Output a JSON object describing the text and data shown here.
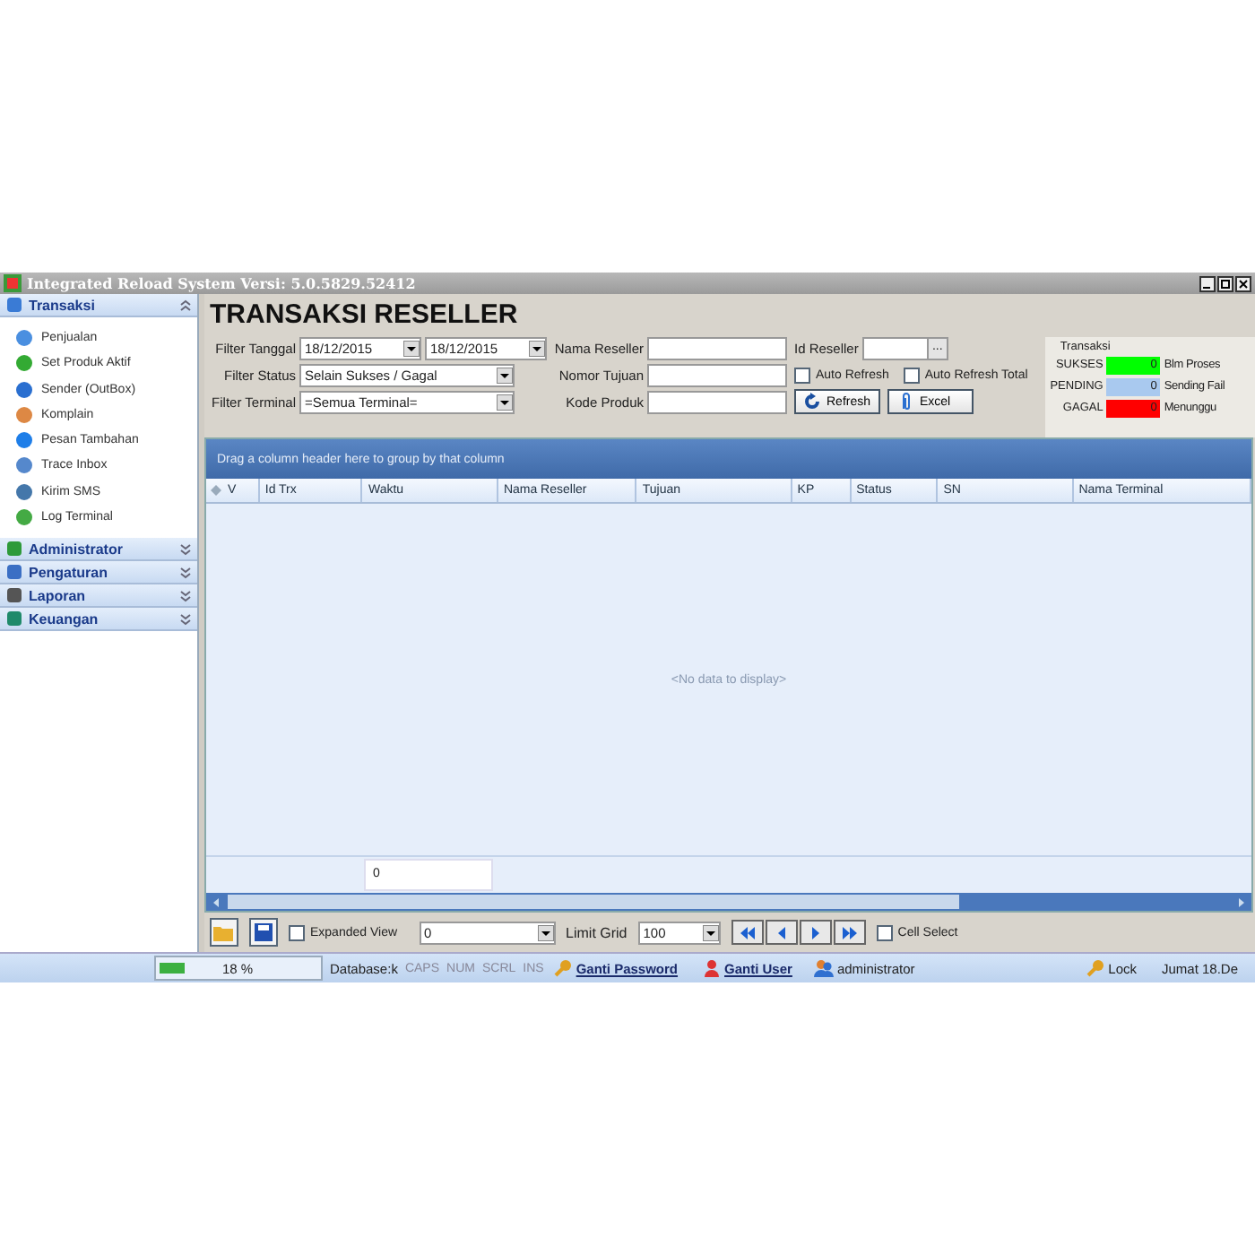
{
  "window": {
    "title": "Integrated Reload System Versi: 5.0.5829.52412"
  },
  "sidebar": {
    "groups": [
      {
        "label": "Transaksi",
        "expanded": true,
        "items": [
          {
            "label": "Penjualan"
          },
          {
            "label": "Set Produk Aktif"
          },
          {
            "label": "Sender (OutBox)"
          },
          {
            "label": "Komplain"
          },
          {
            "label": "Pesan Tambahan"
          },
          {
            "label": "Trace Inbox"
          },
          {
            "label": "Kirim SMS"
          },
          {
            "label": "Log Terminal"
          }
        ]
      },
      {
        "label": "Administrator",
        "expanded": false
      },
      {
        "label": "Pengaturan",
        "expanded": false
      },
      {
        "label": "Laporan",
        "expanded": false
      },
      {
        "label": "Keuangan",
        "expanded": false
      }
    ]
  },
  "page_title": "TRANSAKSI RESELLER",
  "filters": {
    "tanggal": {
      "label": "Filter Tanggal",
      "from": "18/12/2015",
      "to": "18/12/2015"
    },
    "status": {
      "label": "Filter Status",
      "value": "Selain Sukses / Gagal"
    },
    "terminal": {
      "label": "Filter Terminal",
      "value": "=Semua Terminal="
    },
    "text_fields": [
      {
        "label": "Nama Reseller"
      },
      {
        "label": "Nomor Tujuan"
      },
      {
        "label": "Kode Produk"
      }
    ],
    "id_reseller": {
      "label": "Id Reseller",
      "button": "..."
    },
    "checkboxes": [
      {
        "label": "Auto Refresh",
        "checked": false
      },
      {
        "label": "Auto Refresh Total",
        "checked": false
      }
    ],
    "buttons": [
      {
        "label": "Refresh"
      },
      {
        "label": "Excel"
      }
    ]
  },
  "summary": {
    "title": "Transaksi",
    "rows": [
      {
        "label": "SUKSES",
        "value": "0",
        "color": "#00ff00",
        "side": "Blm Proses"
      },
      {
        "label": "PENDING",
        "value": "0",
        "color": "#a9c9ef",
        "side": "Sending Fail"
      },
      {
        "label": "GAGAL",
        "value": "0",
        "color": "#ff0000",
        "side": "Menunggu"
      }
    ]
  },
  "grid": {
    "group_panel": "Drag a column header here to group by that column",
    "columns": [
      "V",
      "Id Trx",
      "Waktu",
      "Nama Reseller",
      "Tujuan",
      "KP",
      "Status",
      "SN",
      "Nama Terminal"
    ],
    "empty_text": "<No data to display>",
    "footer_total": "0"
  },
  "toolbar": {
    "expanded_view": {
      "label": "Expanded View",
      "checked": false
    },
    "dropdown": "0",
    "limit_label": "Limit Grid",
    "limit": "100",
    "cell_select": {
      "label": "Cell Select",
      "checked": false
    }
  },
  "status_bar": {
    "progress": {
      "level": 0.18,
      "text": "18 %"
    },
    "database": "Database:k",
    "keys": [
      {
        "label": "CAPS",
        "on": false
      },
      {
        "label": "NUM",
        "on": false
      },
      {
        "label": "SCRL",
        "on": false
      },
      {
        "label": "INS",
        "on": false
      }
    ],
    "links": [
      {
        "label": "Ganti Password"
      },
      {
        "label": "Ganti User"
      }
    ],
    "user": "administrator",
    "lock": "Lock",
    "date": "Jumat 18.De"
  }
}
